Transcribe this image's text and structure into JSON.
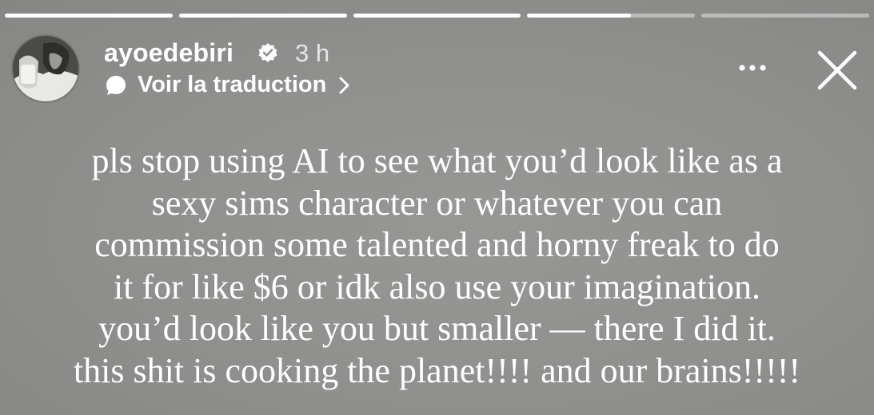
{
  "progress": {
    "segments": [
      1,
      1,
      1,
      0.62,
      0
    ]
  },
  "header": {
    "username": "ayoedebiri",
    "time": "3 h",
    "translate_label": "Voir la traduction",
    "icons": {
      "verified": "verified-badge-icon",
      "translate": "speech-bubble-icon",
      "chevron": "chevron-right-icon",
      "more": "more-options-icon",
      "close": "close-icon"
    }
  },
  "story": {
    "lines": [
      "pls stop using AI to see what you’d look like as a",
      "sexy sims character or whatever you can",
      "commission some talented and horny freak to do",
      "it for like $6 or idk also use your imagination.",
      "you’d look like you but smaller — there I did it.",
      "this shit is cooking the planet!!!! and our brains!!!!!"
    ]
  },
  "colors": {
    "background": "#8f8f8d",
    "text": "#ffffff"
  }
}
